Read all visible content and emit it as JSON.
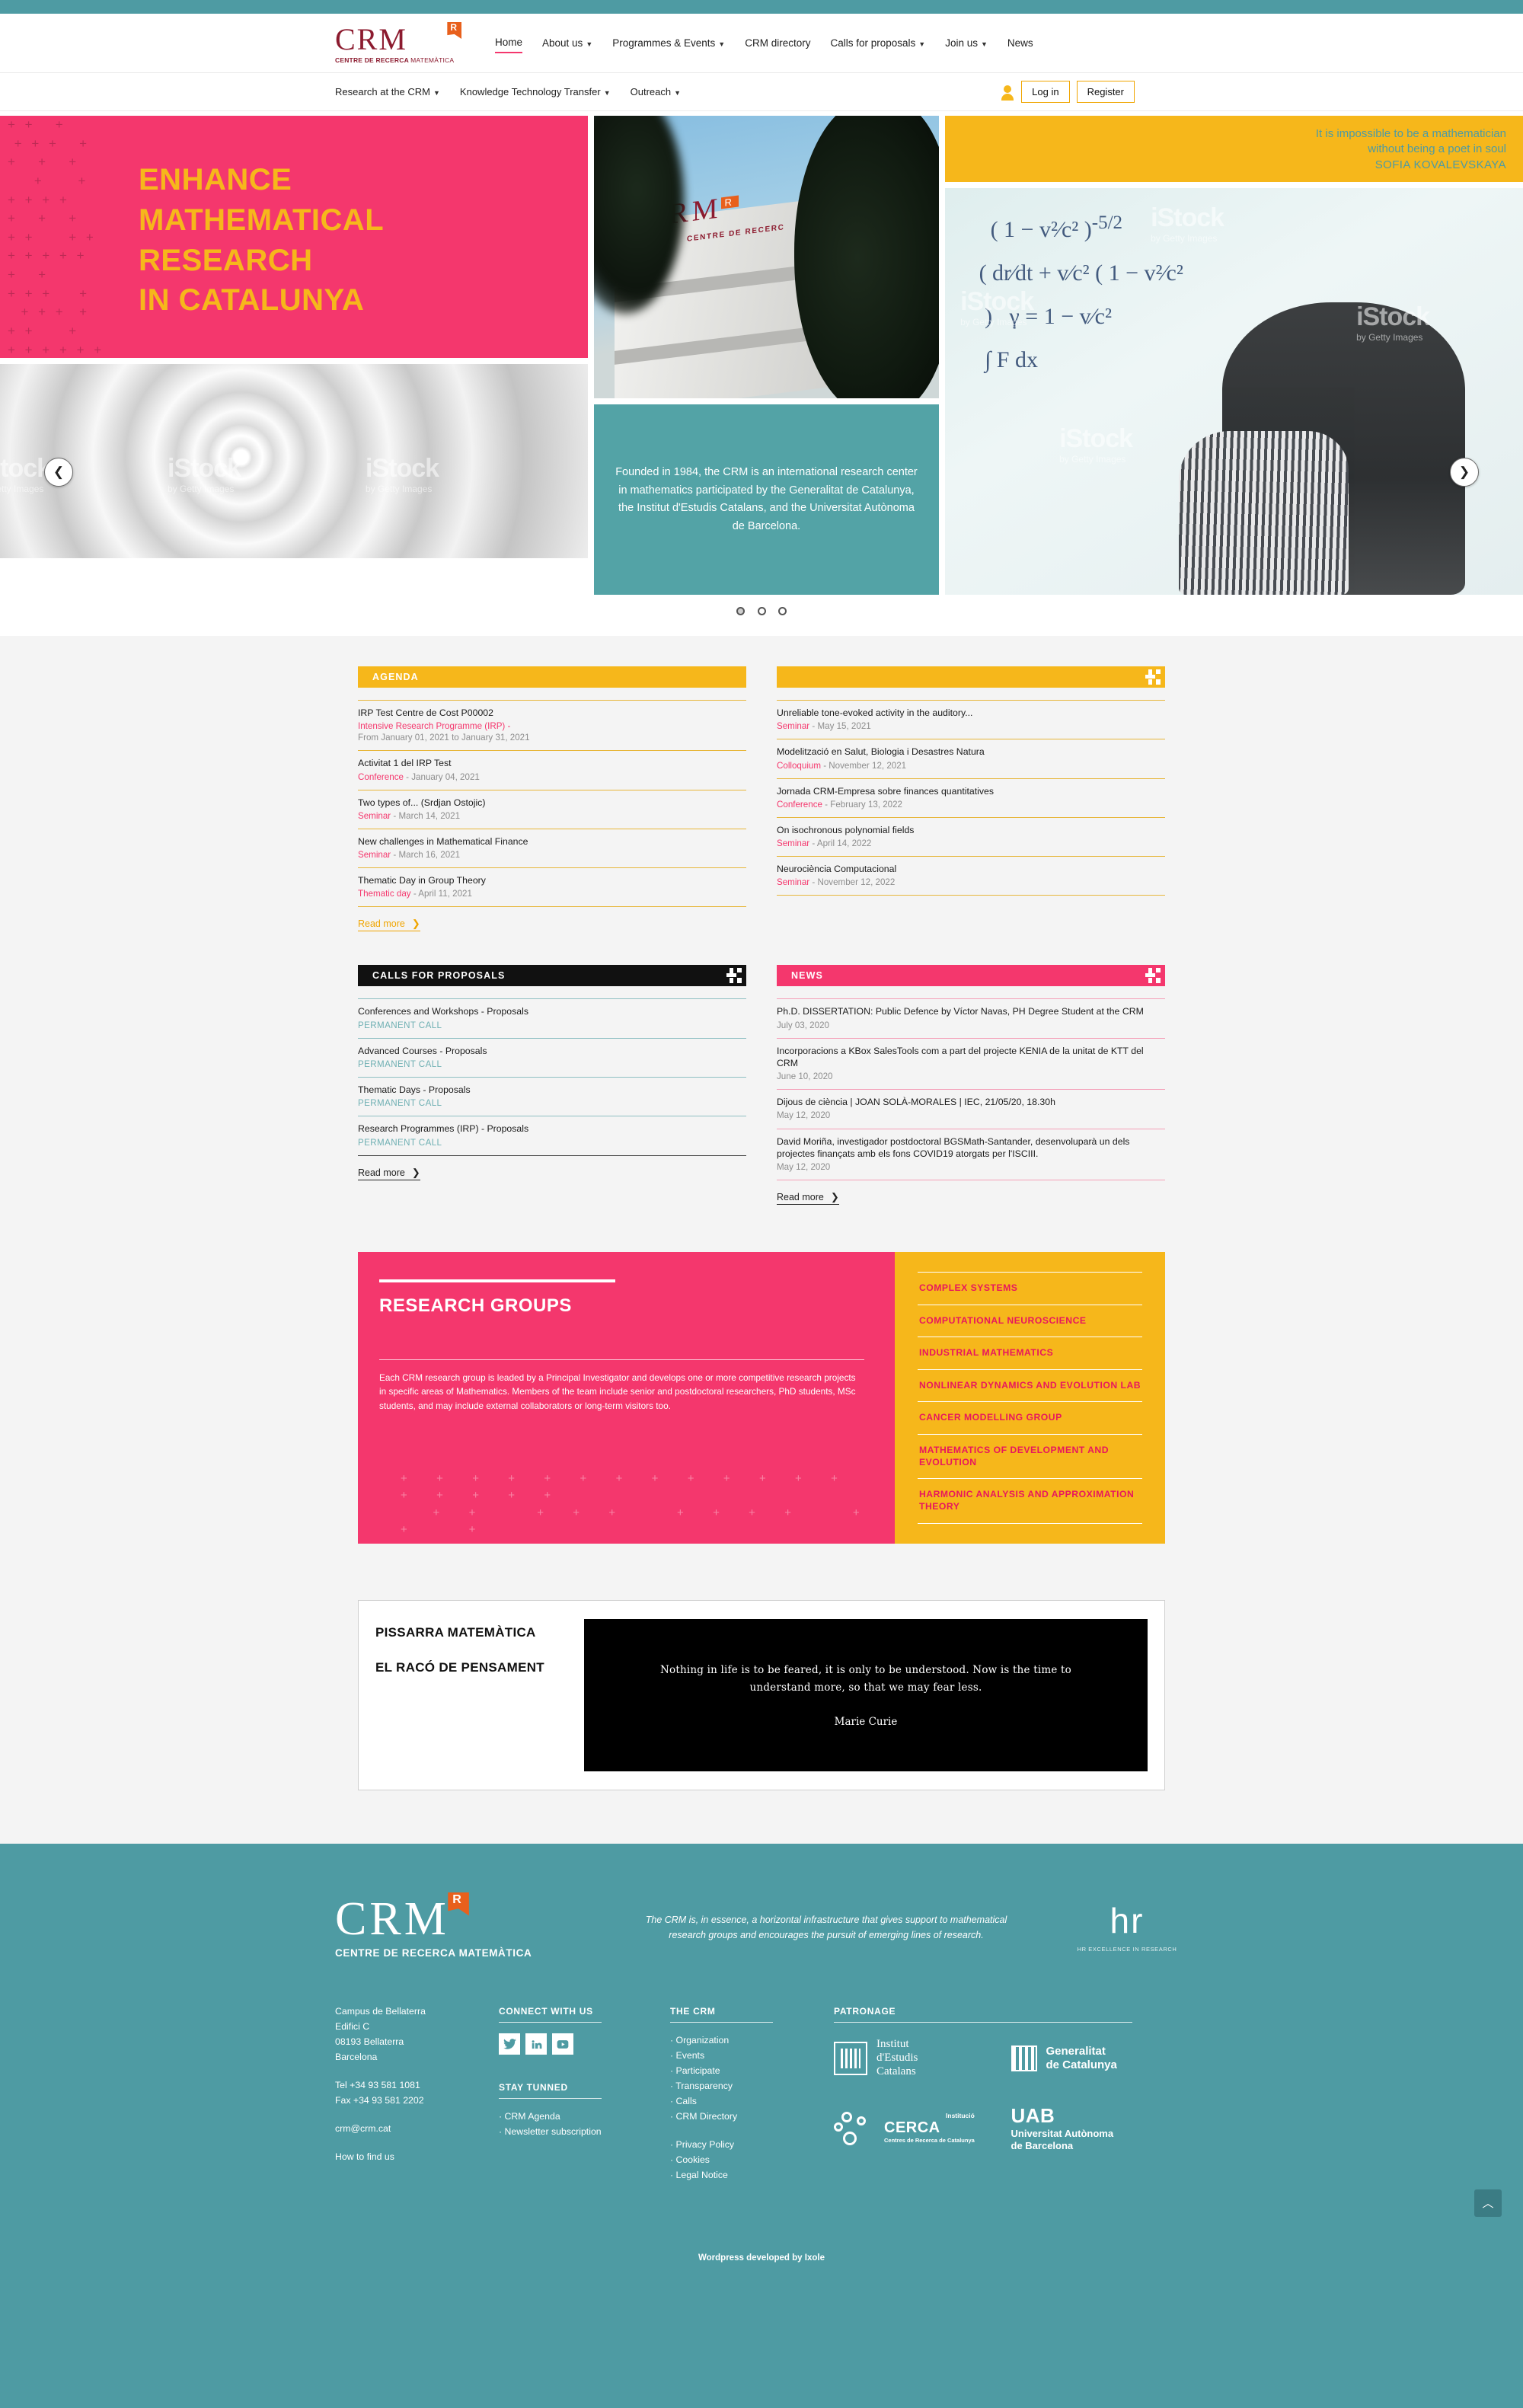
{
  "header": {
    "logo": {
      "main": "CRM",
      "sup": "R",
      "sub_bold": "CENTRE DE RECERCA",
      "sub_light": "MATEMÀTICA"
    },
    "nav": [
      {
        "label": "Home",
        "caret": false,
        "active": true
      },
      {
        "label": "About us",
        "caret": true,
        "active": false
      },
      {
        "label": "Programmes & Events",
        "caret": true,
        "active": false
      },
      {
        "label": "CRM directory",
        "caret": false,
        "active": false
      },
      {
        "label": "Calls for proposals",
        "caret": true,
        "active": false
      },
      {
        "label": "Join us",
        "caret": true,
        "active": false
      },
      {
        "label": "News",
        "caret": false,
        "active": false
      }
    ],
    "subnav": [
      {
        "label": "Research at the CRM",
        "caret": true
      },
      {
        "label": "Knowledge Technology Transfer",
        "caret": true
      },
      {
        "label": "Outreach",
        "caret": true
      }
    ],
    "auth": {
      "login": "Log in",
      "register": "Register",
      "user_icon": "user-icon"
    }
  },
  "hero": {
    "headline_lines": [
      "ENHANCE",
      "MATHEMATICAL",
      "RESEARCH",
      "IN CATALUNYA"
    ],
    "intro": "Founded in 1984, the CRM is an international research center in mathematics participated by the Generalitat de Catalunya, the Institut d'Estudis Catalans, and the Universitat Autònoma de Barcelona.",
    "quote_line1": "It is impossible to be a mathematician",
    "quote_line2": "without being a poet in soul",
    "quote_author": "SOFIA KOVALEVSKAYA",
    "building_logo": "CRM",
    "building_sub": "CENTRE DE RECERC",
    "watermark": "iStock",
    "watermark_sub": "by Getty Images",
    "prev_icon": "chevron-left-icon",
    "next_icon": "chevron-right-icon",
    "dots": 3,
    "active_dot": 0,
    "plus_pattern": "+ +   +\n + + +   +\n+   +   +\n    +     +\n+ + + +\n+   +   +\n+ +     + +\n+ + + + +\n+   +\n+ + +    +\n  + + +  +\n+ +     +\n+ + + + + +\n  + +\n+ + +   +\n+ +   +\n+ + + + + +"
  },
  "agenda": {
    "title": "AGENDA",
    "read_more": "Read more",
    "left": [
      {
        "title": "IRP Test Centre de Cost P00002",
        "tag": "Intensive Research Programme (IRP) -",
        "date": "From January 01, 2021 to January 31, 2021",
        "two_line": true
      },
      {
        "title": "Activitat 1 del IRP Test",
        "tag": "Conference",
        "date": " - January 04, 2021"
      },
      {
        "title": "Two types of... (Srdjan Ostojic)",
        "tag": "Seminar",
        "date": " - March 14, 2021"
      },
      {
        "title": "New challenges in Mathematical Finance",
        "tag": "Seminar",
        "date": " - March 16, 2021"
      },
      {
        "title": "Thematic Day in Group Theory",
        "tag": "Thematic day",
        "date": " - April 11, 2021"
      }
    ],
    "right": [
      {
        "title": "Unreliable tone-evoked activity in the auditory...",
        "tag": "Seminar",
        "date": " - May 15, 2021"
      },
      {
        "title": "Modelització en Salut, Biologia i Desastres Natura",
        "tag": "Colloquium",
        "date": " - November 12, 2021"
      },
      {
        "title": "Jornada CRM-Empresa sobre finances quantitatives",
        "tag": "Conference",
        "date": " - February 13, 2022"
      },
      {
        "title": "On isochronous polynomial fields",
        "tag": "Seminar",
        "date": " - April 14, 2022"
      },
      {
        "title": "Neurociència Computacional",
        "tag": "Seminar",
        "date": " - November 12, 2022"
      }
    ]
  },
  "calls": {
    "title": "CALLS FOR PROPOSALS",
    "read_more": "Read more",
    "items": [
      {
        "title": "Conferences and Workshops - Proposals",
        "meta": "PERMANENT CALL"
      },
      {
        "title": "Advanced Courses - Proposals",
        "meta": "PERMANENT CALL"
      },
      {
        "title": "Thematic Days - Proposals",
        "meta": "PERMANENT CALL"
      },
      {
        "title": "Research Programmes (IRP) - Proposals",
        "meta": "PERMANENT CALL"
      }
    ]
  },
  "news": {
    "title": "NEWS",
    "read_more": "Read more",
    "items": [
      {
        "title": "Ph.D. DISSERTATION: Public Defence by Víctor Navas, PH Degree Student at the CRM",
        "date": "July 03, 2020"
      },
      {
        "title": "Incorporacions a KBox SalesTools com a part del projecte KENIA de la unitat de KTT del CRM",
        "date": "June 10, 2020"
      },
      {
        "title": "Dijous de ciència | JOAN SOLÀ-MORALES | IEC, 21/05/20, 18.30h",
        "date": "May 12, 2020"
      },
      {
        "title": "David Moriña, investigador postdoctoral BGSMath-Santander, desenvoluparà un dels projectes finançats amb els fons COVID19 atorgats per l'ISCIII.",
        "date": "May 12, 2020"
      }
    ]
  },
  "research_groups": {
    "title": "RESEARCH GROUPS",
    "description": "Each CRM research group is leaded by a Principal Investigator and develops one or more competitive research projects in specific areas of Mathematics. Members of the team include senior and postdoctoral researchers, PhD students, MSc students, and may include external collaborators or long-term visitors too.",
    "items": [
      "COMPLEX SYSTEMS",
      "COMPUTATIONAL NEUROSCIENCE",
      "INDUSTRIAL MATHEMATICS",
      "NONLINEAR DYNAMICS AND EVOLUTION LAB",
      "CANCER MODELLING GROUP",
      "MATHEMATICS OF DEVELOPMENT AND EVOLUTION",
      "HARMONIC ANALYSIS AND APPROXIMATION THEORY"
    ],
    "plus_pattern": "+  +  +  +  +  +  +  +  +  +  +  +  +  +  +  +  +  +\n   +  +     +  +  +     +  +  +  +     +  +     +\n+     +  +     +  +  +  +     +     +  +  +  +  +"
  },
  "pissarra": {
    "heading1": "PISSARRA MATEMÀTICA",
    "heading2": "EL RACÓ DE PENSAMENT",
    "quote": "Nothing in life is to be feared, it is only to be understood. Now is the time to understand more, so that we may fear less.",
    "author": "Marie Curie"
  },
  "footer": {
    "logo": {
      "main": "CRM",
      "sup": "R",
      "sub": "CENTRE DE RECERCA MATEMÀTICA"
    },
    "tagline": "The CRM is, in essence, a horizontal infrastructure that gives support to mathematical research groups and encourages the pursuit of emerging lines of research.",
    "hr_badge": {
      "mark": "hr",
      "sub": "HR EXCELLENCE IN RESEARCH"
    },
    "address": [
      "Campus de Bellaterra",
      "Edifici C",
      "08193 Bellaterra",
      "Barcelona"
    ],
    "phone": "Tel +34 93 581 1081",
    "fax": "Fax +34 93 581 2202",
    "email": "crm@crm.cat",
    "how_to_find": "How to find us",
    "connect_title": "CONNECT WITH US",
    "socials": [
      "twitter-icon",
      "linkedin-icon",
      "youtube-icon"
    ],
    "stay_title": "STAY TUNNED",
    "stay_items": [
      "CRM Agenda",
      "Newsletter subscription"
    ],
    "crm_title": "THE CRM",
    "crm_items": [
      "Organization",
      "Events",
      "Participate",
      "Transparency",
      "Calls",
      "CRM Directory"
    ],
    "legal_items": [
      "Privacy Policy",
      "Cookies",
      "Legal Notice"
    ],
    "patronage_title": "PATRONAGE",
    "patrons": [
      {
        "name_line1": "Institut",
        "name_line2": "d'Estudis",
        "name_line3": "Catalans",
        "mark": "iec-shield-icon"
      },
      {
        "name_line1": "Generalitat",
        "name_line2": "de Catalunya",
        "mark": "generalitat-icon"
      },
      {
        "name_line1": "Institució",
        "name_line2": "CERCA",
        "name_line3": "Centres de Recerca de Catalunya",
        "mark": "cerca-icon"
      },
      {
        "name_line1": "UAB",
        "name_line2": "Universitat Autònoma",
        "name_line3": "de Barcelona",
        "mark": "uab-icon"
      }
    ],
    "credit": "Wordpress developed by Ixole",
    "to_top_icon": "chevron-up-icon"
  }
}
